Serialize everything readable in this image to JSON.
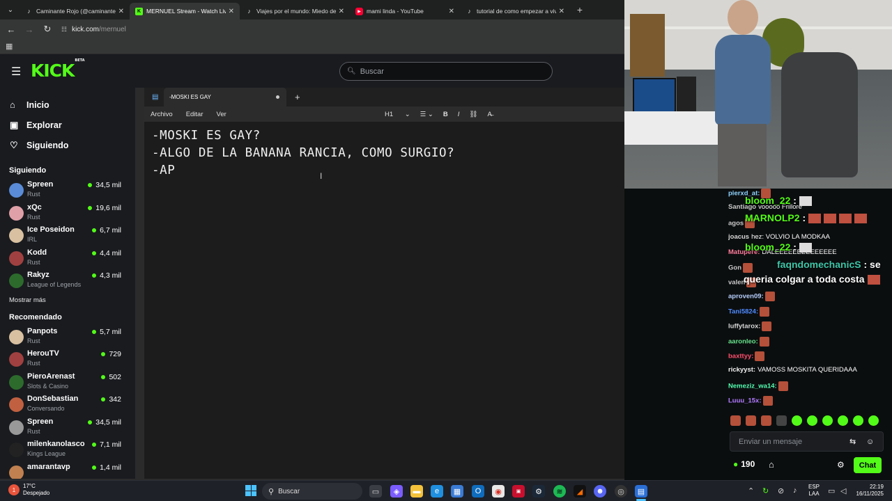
{
  "browser": {
    "tabs": [
      {
        "title": "Caminante Rojo (@caminante_r",
        "icon": "tiktok-icon"
      },
      {
        "title": "MERNUEL Stream - Watch Live",
        "icon": "kick-icon"
      },
      {
        "title": "Viajes por el mundo: Miedo de",
        "icon": "tiktok-icon"
      },
      {
        "title": "mami linda - YouTube",
        "icon": "youtube-icon"
      },
      {
        "title": "tutorial de como empezar a viv",
        "icon": "tiktok-icon"
      }
    ],
    "url_host": "kick.com",
    "url_path": "/mernuel"
  },
  "kick": {
    "logo": "KICK",
    "logo_badge": "BETA",
    "search_placeholder": "Buscar",
    "nav": [
      {
        "label": "Inicio",
        "icon": "home-icon"
      },
      {
        "label": "Explorar",
        "icon": "explore-icon"
      },
      {
        "label": "Siguiendo",
        "icon": "heart-icon"
      }
    ],
    "following_title": "Siguiendo",
    "following": [
      {
        "name": "Spreen",
        "category": "Rust",
        "viewers": "34,5 mil"
      },
      {
        "name": "xQc",
        "category": "Rust",
        "viewers": "19,6 mil"
      },
      {
        "name": "Ice Poseidon",
        "category": "IRL",
        "viewers": "6,7 mil"
      },
      {
        "name": "Kodd",
        "category": "Rust",
        "viewers": "4,4 mil"
      },
      {
        "name": "Rakyz",
        "category": "League of Legends",
        "viewers": "4,3 mil"
      }
    ],
    "show_more": "Mostrar más",
    "recommended_title": "Recomendado",
    "recommended": [
      {
        "name": "Panpots",
        "category": "Rust",
        "viewers": "5,7 mil"
      },
      {
        "name": "HerouTV",
        "category": "Rust",
        "viewers": "729"
      },
      {
        "name": "PieroArenast",
        "category": "Slots & Casino",
        "viewers": "502"
      },
      {
        "name": "DonSebastian",
        "category": "Conversando",
        "viewers": "342"
      },
      {
        "name": "Spreen",
        "category": "Rust",
        "viewers": "34,5 mil"
      },
      {
        "name": "milenkanolasco",
        "category": "Kings League",
        "viewers": "7,1 mil"
      },
      {
        "name": "amarantavp",
        "category": "",
        "viewers": "1,4 mil"
      }
    ]
  },
  "notepad": {
    "tab_title": "-MOSKI ES GAY",
    "menu": [
      "Archivo",
      "Editar",
      "Ver"
    ],
    "tool_heading": "H1",
    "lines": [
      "-MOSKI ES GAY?",
      "-ALGO DE LA BANANA RANCIA, COMO SURGIO?",
      "-AP"
    ]
  },
  "chat": {
    "messages": [
      {
        "user": "pierxd_at:",
        "text": "",
        "color": "#8fd4ff"
      },
      {
        "user": "Santiago",
        "text": "vooooo Frillore",
        "color": "#c8c8c8"
      },
      {
        "user": "agos",
        "text": "",
        "color": "#c8c8c8"
      },
      {
        "user": "joacus",
        "text": "hez: VOLVIO LA MODKAA",
        "color": "#d6d6d6"
      },
      {
        "user": "Matupere:",
        "text": "DALEEEEEEEEEEEEEE",
        "color": "#ff7b9b"
      },
      {
        "user": "Gon",
        "text": "",
        "color": "#c8c8c8"
      },
      {
        "user": "valen",
        "text": "",
        "color": "#c8c8c8"
      },
      {
        "user": "aproven09:",
        "text": "",
        "color": "#b8d0ff"
      },
      {
        "user": "Tani5824:",
        "text": "",
        "color": "#4f8bff"
      },
      {
        "user": "luffytarox:",
        "text": "",
        "color": "#d9d9d9"
      },
      {
        "user": "aaronleo:",
        "text": "",
        "color": "#66e28b"
      },
      {
        "user": "baxttyy:",
        "text": "",
        "color": "#ff4f6d"
      },
      {
        "user": "rickyyst:",
        "text": "VAMOSS MOSKITA QUERIDAAA",
        "color": "#f0f0f0"
      },
      {
        "user": "Nemeziz_wa14:",
        "text": "",
        "color": "#53fcb0"
      },
      {
        "user": "Luuu_15x:",
        "text": "",
        "color": "#b17bff"
      }
    ],
    "overlay": [
      {
        "user": "bloom_22",
        "text": ":"
      },
      {
        "user": "MARNOLP2",
        "text": ":"
      },
      {
        "user": "bloom_22",
        "text": ":"
      },
      {
        "user": "faqndomechanicS",
        "text": ": se"
      },
      {
        "user": "",
        "text": "queria colgar a toda costa"
      }
    ],
    "input_placeholder": "Enviar un mensaje",
    "points": "190",
    "chat_button": "Chat"
  },
  "taskbar": {
    "temp": "17°C",
    "weather": "Despejado",
    "search": "Buscar",
    "lang1": "ESP",
    "lang2": "LAA",
    "time": "22:19",
    "date": "16/11/2025"
  }
}
